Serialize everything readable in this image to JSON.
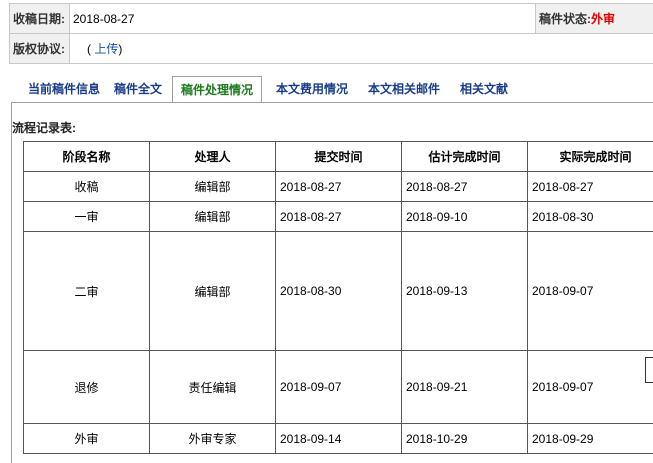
{
  "info": {
    "received_label": "收稿日期:",
    "received_value": "2018-08-27",
    "status_label": "稿件状态:",
    "status_value": "外审",
    "copyright_label": "版权协议:",
    "copyright_open": "(",
    "copyright_link": "上传",
    "copyright_close": ")"
  },
  "tabs": [
    {
      "label": "当前稿件信息"
    },
    {
      "label": "稿件全文"
    },
    {
      "label": "稿件处理情况"
    },
    {
      "label": "本文费用情况"
    },
    {
      "label": "本文相关邮件"
    },
    {
      "label": "相关文献"
    }
  ],
  "flow": {
    "title": "流程记录表:",
    "headers": [
      "阶段名称",
      "处理人",
      "提交时间",
      "估计完成时间",
      "实际完成时间"
    ],
    "rows": [
      {
        "stage": "收稿",
        "handler": "编辑部",
        "submitted": "2018-08-27",
        "estimated": "2018-08-27",
        "actual": "2018-08-27"
      },
      {
        "stage": "一审",
        "handler": "编辑部",
        "submitted": "2018-08-27",
        "estimated": "2018-09-10",
        "actual": "2018-08-30"
      },
      {
        "stage": "二审",
        "handler": "编辑部",
        "submitted": "2018-08-30",
        "estimated": "2018-09-13",
        "actual": "2018-09-07"
      },
      {
        "stage": "退修",
        "handler": "责任编辑",
        "submitted": "2018-09-07",
        "estimated": "2018-09-21",
        "actual": "2018-09-07"
      },
      {
        "stage": "外审",
        "handler": "外审专家",
        "submitted": "2018-09-14",
        "estimated": "2018-10-29",
        "actual": "2018-09-29"
      }
    ]
  },
  "colors": {
    "tab_text": "#1a3d8a",
    "tab_active_text": "#1c7a1c",
    "status_value": "#e00000",
    "label_bg": "#f0f0f0"
  }
}
